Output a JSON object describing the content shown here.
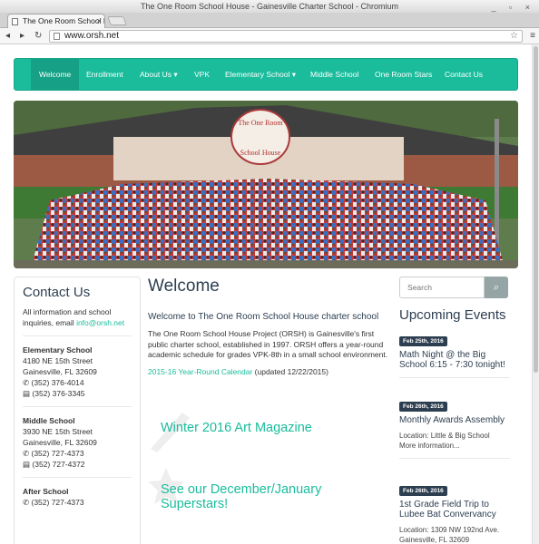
{
  "window": {
    "title": "The One Room School House - Gainesville Charter School - Chromium",
    "controls": "_ ▫ ×"
  },
  "tab": {
    "title": "The One Room School Ho",
    "close": "×"
  },
  "toolbar": {
    "back": "◂",
    "forward": "▸",
    "reload": "↻",
    "url": "www.orsh.net",
    "star": "☆",
    "menu": "≡"
  },
  "nav": {
    "items": [
      "Welcome",
      "Enrollment",
      "About Us ▾",
      "VPK",
      "Elementary School ▾",
      "Middle School",
      "One Room Stars",
      "Contact Us"
    ]
  },
  "hero": {
    "sign_line1": "The One Room",
    "sign_line2": "School House"
  },
  "contact": {
    "title": "Contact Us",
    "intro": "All information and school inquiries, email ",
    "email": "info@orsh.net",
    "elementary": {
      "name": "Elementary School",
      "address1": "4180 NE 15th Street",
      "address2": "Gainesville, FL 32609",
      "phone": "(352) 376-4014",
      "fax": "(352) 376-3345"
    },
    "middle": {
      "name": "Middle School",
      "address1": "3930 NE 15th Street",
      "address2": "Gainesville, FL 32609",
      "phone": "(352) 727-4373",
      "fax": "(352) 727-4372"
    },
    "after": {
      "name": "After School",
      "phone": "(352) 727-4373"
    }
  },
  "main": {
    "title": "Welcome",
    "subtitle": "Welcome to The One Room School House charter school",
    "body": "The One Room School House Project (ORSH) is Gainesville's first public charter school, established in 1997. ORSH offers a year-round academic schedule for grades VPK-8th in a small school environment.",
    "calendar_link": "2015-16 Year-Round Calendar",
    "calendar_note": " (updated 12/22/2015)",
    "promo1": "Winter 2016 Art Magazine",
    "promo2": "See our December/January Superstars!"
  },
  "search": {
    "placeholder": "Search",
    "icon": "⌕"
  },
  "events": {
    "heading": "Upcoming Events",
    "items": [
      {
        "date": "Feb 25th, 2016",
        "title": "Math Night @ the Big School 6:15 - 7:30 tonight!"
      },
      {
        "date": "Feb 26th, 2016",
        "title": "Monthly Awards Assembly",
        "location": "Location: Little & Big School",
        "more": "More information..."
      },
      {
        "date": "Feb 26th, 2016",
        "title": "1st Grade Field Trip to Lubee Bat Convervancy",
        "location": "Location: 1309 NW 192nd Ave. Gainesville, FL 32609"
      }
    ]
  },
  "colors": {
    "accent": "#1abc9c",
    "accent_dark": "#16a085",
    "heading": "#2c3e50"
  }
}
